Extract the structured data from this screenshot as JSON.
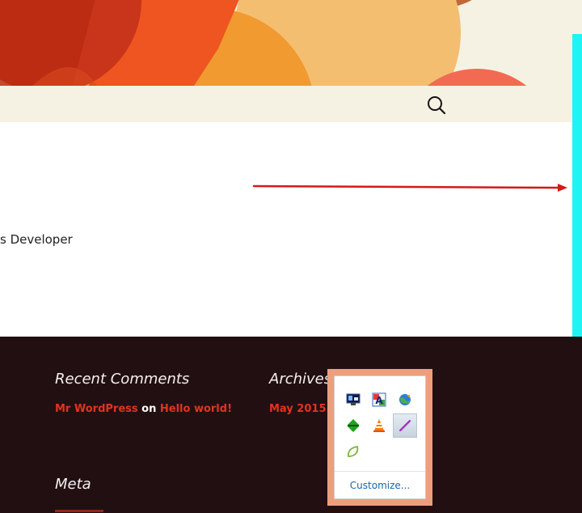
{
  "header": {
    "search_icon": "search-icon",
    "accent_colors": [
      "#e03a10",
      "#f19a30",
      "#f4be70",
      "#f6f2e3"
    ]
  },
  "main": {
    "tagline_fragment": "s Developer",
    "annotation_arrow_color": "#d41a1a",
    "side_bar_color": "#1ff4f4"
  },
  "footer": {
    "recent_comments": {
      "title": "Recent Comments",
      "author": "Mr WordPress",
      "connector": "on",
      "post": "Hello world!"
    },
    "archives": {
      "title": "Archives",
      "item": "May 2015"
    },
    "meta": {
      "title": "Meta"
    }
  },
  "tray": {
    "icons": [
      "network-monitor-icon",
      "font-app-icon",
      "globe-download-icon",
      "sort-arrows-icon",
      "vlc-cone-icon",
      "pen-icon",
      "leaf-icon"
    ],
    "customize_label": "Customize..."
  }
}
